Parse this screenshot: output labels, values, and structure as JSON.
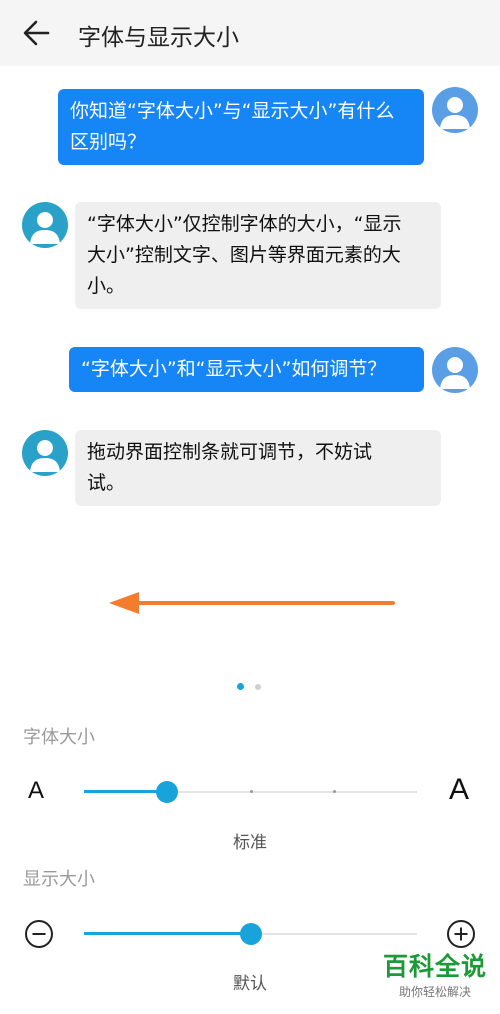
{
  "header": {
    "title": "字体与显示大小",
    "back_icon": "arrow-left-icon"
  },
  "messages": [
    {
      "side": "out",
      "text_lines": [
        "你知道“字体大小”与“显示大小”有什么",
        "区别吗？"
      ]
    },
    {
      "side": "in",
      "text_lines": [
        "“字体大小”仅控制字体的大小，“显示",
        "大小”控制文字、图片等界面元素的大",
        "小。"
      ]
    },
    {
      "side": "out",
      "text_lines": [
        "“字体大小”和“显示大小”如何调节？"
      ]
    },
    {
      "side": "in",
      "text_lines": [
        "拖动界面控制条就可调节，不妨试",
        "试。"
      ]
    }
  ],
  "pager": {
    "total": 2,
    "active_index": 0
  },
  "font_size": {
    "label": "字体大小",
    "small_glyph": "A",
    "large_glyph": "A",
    "caption": "标准",
    "steps": 5,
    "value_index": 1
  },
  "display_size": {
    "label": "显示大小",
    "minus_icon": "minus-circle-icon",
    "plus_icon": "plus-circle-icon",
    "caption": "默认",
    "value_fraction": 0.5
  },
  "watermark": {
    "title": "百科全说",
    "subtitle": "助你轻松解决"
  },
  "colors": {
    "accent": "#18a3da",
    "bubble_out": "#1685f5",
    "bubble_in": "#efefef",
    "swipe_arrow": "#f47c2e",
    "watermark_green": "#1d9a38"
  }
}
